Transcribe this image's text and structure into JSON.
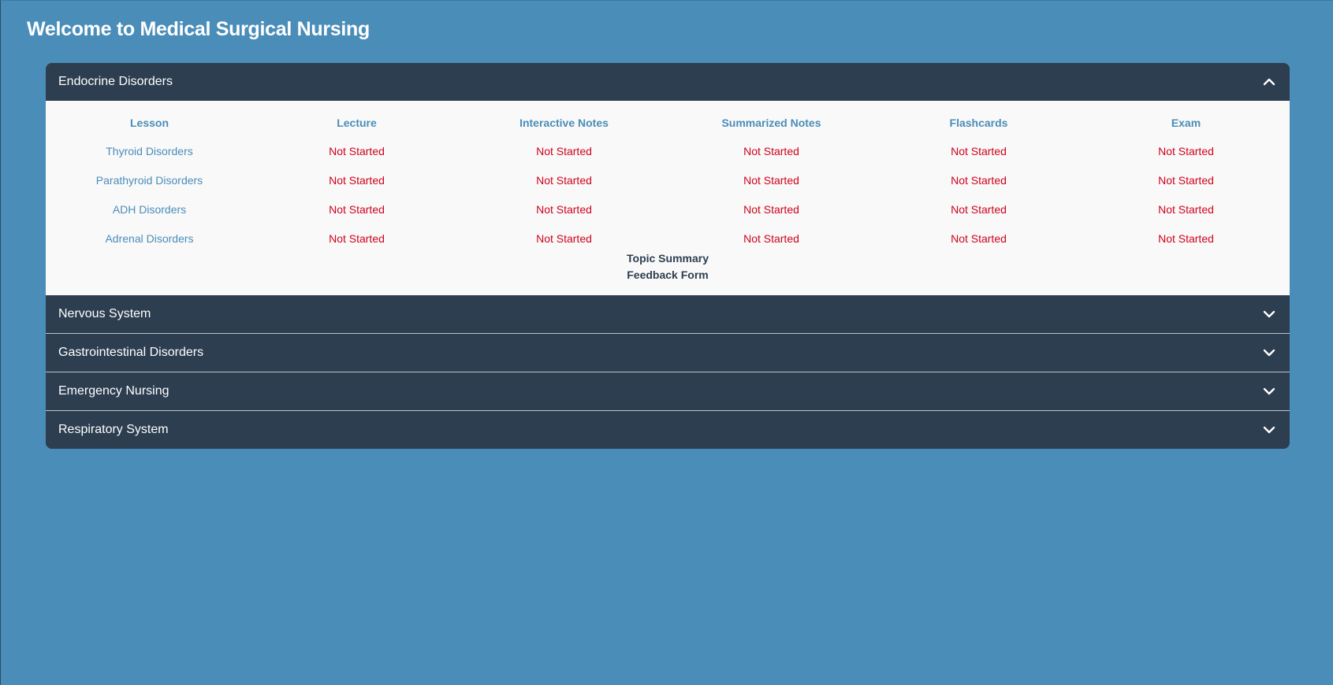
{
  "page": {
    "title": "Welcome to Medical Surgical Nursing"
  },
  "colors": {
    "background": "#4a8db9",
    "header": "#2d3e50",
    "panel": "#f9f9f9",
    "accent": "#4a8db9",
    "status_not_started": "#d0021b"
  },
  "sections": [
    {
      "title": "Endocrine Disorders",
      "expanded": true,
      "icon": "chevron-up-icon",
      "columns": [
        "Lesson",
        "Lecture",
        "Interactive Notes",
        "Summarized Notes",
        "Flashcards",
        "Exam"
      ],
      "rows": [
        {
          "lesson": "Thyroid Disorders",
          "lecture": "Not Started",
          "interactive": "Not Started",
          "summarized": "Not Started",
          "flashcards": "Not Started",
          "exam": "Not Started"
        },
        {
          "lesson": "Parathyroid Disorders",
          "lecture": "Not Started",
          "interactive": "Not Started",
          "summarized": "Not Started",
          "flashcards": "Not Started",
          "exam": "Not Started"
        },
        {
          "lesson": "ADH Disorders",
          "lecture": "Not Started",
          "interactive": "Not Started",
          "summarized": "Not Started",
          "flashcards": "Not Started",
          "exam": "Not Started"
        },
        {
          "lesson": "Adrenal Disorders",
          "lecture": "Not Started",
          "interactive": "Not Started",
          "summarized": "Not Started",
          "flashcards": "Not Started",
          "exam": "Not Started"
        }
      ],
      "links": {
        "topic_summary": "Topic Summary",
        "feedback_form": "Feedback Form"
      }
    },
    {
      "title": "Nervous System",
      "expanded": false,
      "icon": "chevron-down-icon"
    },
    {
      "title": "Gastrointestinal Disorders",
      "expanded": false,
      "icon": "chevron-down-icon"
    },
    {
      "title": "Emergency Nursing",
      "expanded": false,
      "icon": "chevron-down-icon"
    },
    {
      "title": "Respiratory System",
      "expanded": false,
      "icon": "chevron-down-icon"
    }
  ]
}
